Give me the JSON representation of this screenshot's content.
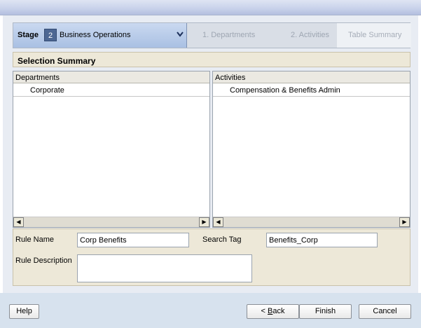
{
  "wizard": {
    "stage_label": "Stage",
    "stage_number": "2",
    "stage_name": "Business Operations",
    "steps": [
      {
        "label": "1. Departments"
      },
      {
        "label": "2. Activities"
      },
      {
        "label": "Table Summary"
      }
    ]
  },
  "summary": {
    "title": "Selection Summary",
    "departments": {
      "header": "Departments",
      "items": [
        "Corporate"
      ]
    },
    "activities": {
      "header": "Activities",
      "items": [
        "Compensation & Benefits Admin"
      ]
    }
  },
  "form": {
    "rule_name_label": "Rule Name",
    "rule_name_value": "Corp Benefits",
    "search_tag_label": "Search Tag",
    "search_tag_value": "Benefits_Corp",
    "rule_description_label": "Rule Description",
    "rule_description_value": ""
  },
  "footer": {
    "help_label": "Help",
    "back_prefix": "< ",
    "back_accel": "B",
    "back_rest": "ack",
    "finish_label": "Finish",
    "cancel_label": "Cancel"
  },
  "icons": {
    "stage_dropdown": "chevron-down-icon",
    "scroll_left": "scroll-left-arrow-icon",
    "scroll_right": "scroll-right-arrow-icon"
  }
}
